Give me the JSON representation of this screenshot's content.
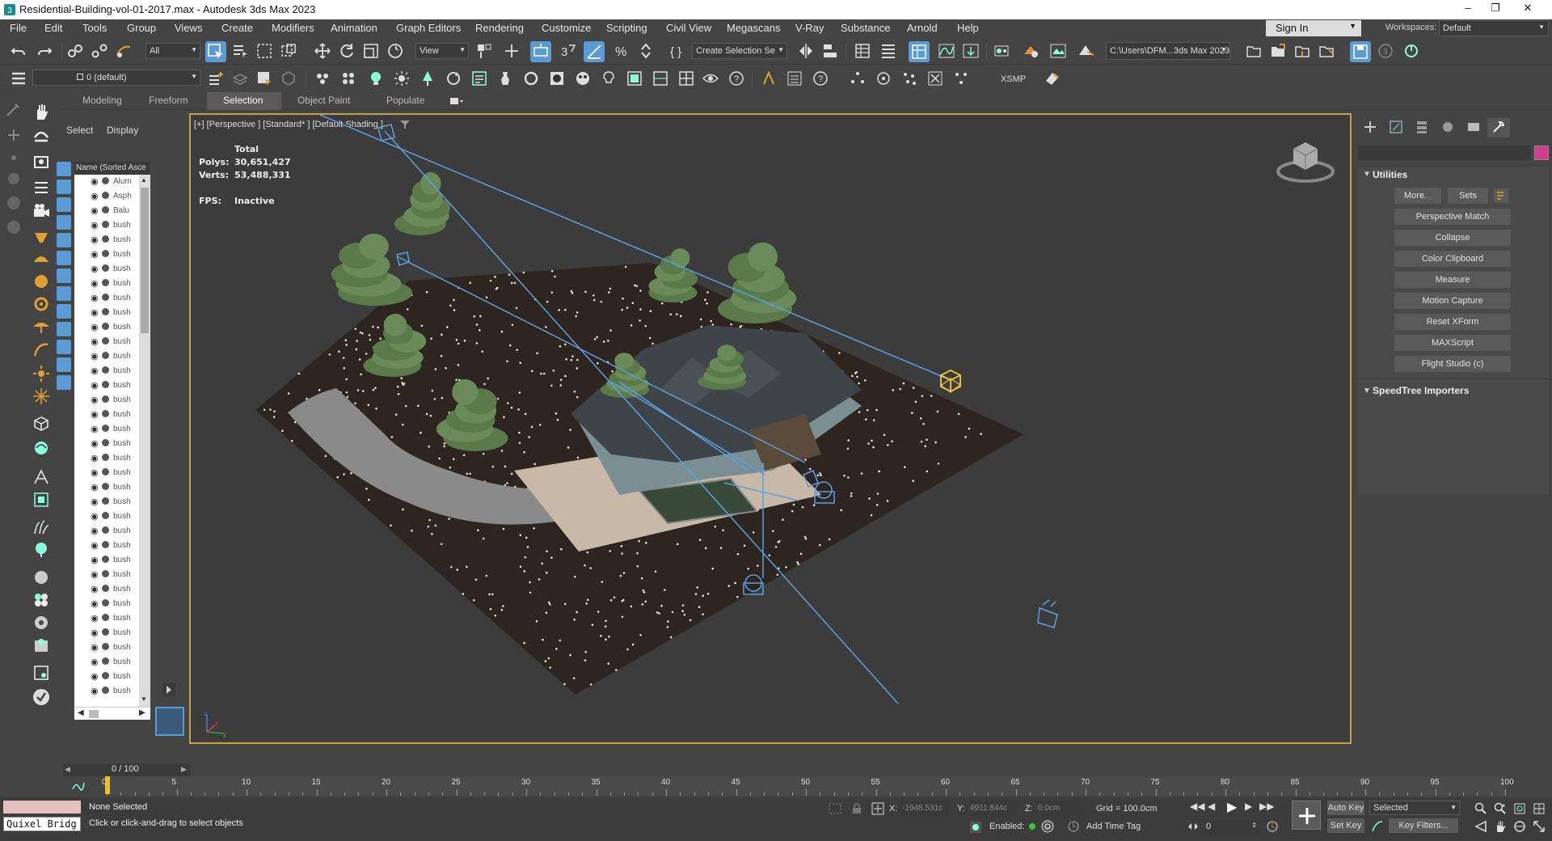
{
  "title": "Residential-Building-vol-01-2017.max - Autodesk 3ds Max 2023",
  "menu": [
    "File",
    "Edit",
    "Tools",
    "Group",
    "Views",
    "Create",
    "Modifiers",
    "Animation",
    "Graph Editors",
    "Rendering",
    "Customize",
    "Scripting",
    "Civil View",
    "Megascans",
    "V-Ray",
    "Substance",
    "Arnold",
    "Help"
  ],
  "sign_in": "Sign In",
  "workspaces_label": "Workspaces:",
  "workspace": "Default",
  "toolbar": {
    "filter": "All",
    "refcoord": "View",
    "selection_set": "Create Selection Se",
    "path": "C:\\Users\\DFM...3ds Max 2023",
    "layer": "0 (default)",
    "xsmp": "XSMP"
  },
  "ribbon_tabs": [
    "Modeling",
    "Freeform",
    "Selection",
    "Object Paint",
    "Populate"
  ],
  "explorer": {
    "tab_select": "Select",
    "tab_display": "Display",
    "column": "Name (Sorted Asce",
    "items": [
      "Alum",
      "Asph",
      "Balu",
      "bush",
      "bush",
      "bush",
      "bush",
      "bush",
      "bush",
      "bush",
      "bush",
      "bush",
      "bush",
      "bush",
      "bush",
      "bush",
      "bush",
      "bush",
      "bush",
      "bush",
      "bush",
      "bush",
      "bush",
      "bush",
      "bush",
      "bush",
      "bush",
      "bush",
      "bush",
      "bush",
      "bush",
      "bush",
      "bush",
      "bush",
      "bush",
      "bush"
    ]
  },
  "viewport": {
    "label": "[+] [Perspective ] [Standard* ] [Default Shading ]",
    "stats_header": "Total",
    "polys_label": "Polys:",
    "polys": "30,651,427",
    "verts_label": "Verts:",
    "verts": "53,488,331",
    "fps_label": "FPS:",
    "fps": "Inactive"
  },
  "cmdpanel": {
    "utilities_title": "Utilities",
    "more": "More...",
    "sets": "Sets",
    "buttons": [
      "Perspective Match",
      "Collapse",
      "Color Clipboard",
      "Measure",
      "Motion Capture",
      "Reset XForm",
      "MAXScript",
      "Flight Studio (c)"
    ],
    "speedtree_title": "SpeedTree Importers"
  },
  "timeline": {
    "frame": "0 / 100",
    "ticks": [
      "0",
      "5",
      "10",
      "15",
      "20",
      "25",
      "30",
      "35",
      "40",
      "45",
      "50",
      "55",
      "60",
      "65",
      "70",
      "75",
      "80",
      "85",
      "90",
      "95",
      "100"
    ]
  },
  "status": {
    "none_selected": "None Selected",
    "hint": "Click or click-and-drag to select objects",
    "quixel": "Quixel Bridg",
    "x_label": "X:",
    "x": "-1948.531c",
    "y_label": "Y:",
    "y": "4911.844c",
    "z_label": "Z:",
    "z": "0.0cm",
    "grid": "Grid = 100.0cm",
    "enabled": "Enabled:",
    "add_time_tag": "Add Time Tag",
    "frame_field": "0",
    "auto_key": "Auto Key",
    "set_key": "Set Key",
    "selected": "Selected",
    "key_filters": "Key Filters..."
  },
  "colors": {
    "viewport_border": "#c8a04a",
    "camera_line": "#5aa0e0",
    "swatch": "#d43c8c"
  }
}
